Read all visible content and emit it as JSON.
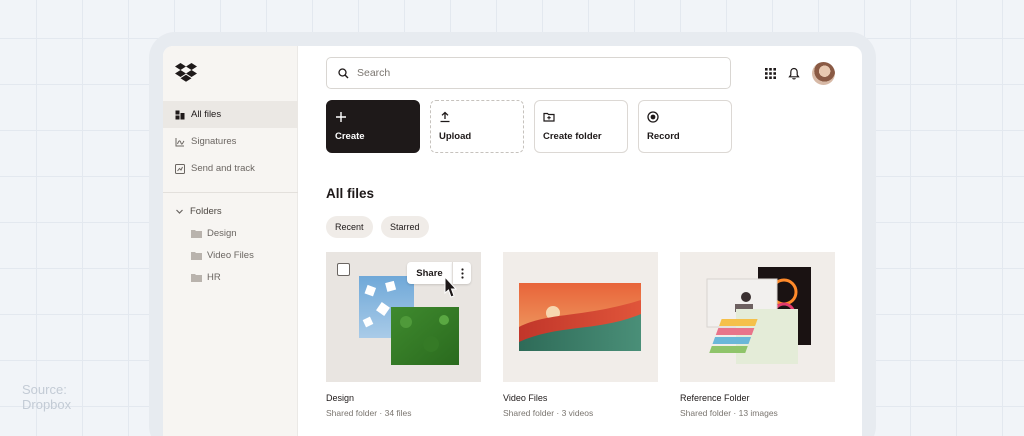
{
  "source_note": "Source:\nDropbox",
  "colors": {
    "primary": "#1e1919",
    "sidebar_bg": "#f7f5f2",
    "accent_chip": "#f0ece8"
  },
  "brand": {
    "logo_icon": "dropbox-logo-icon"
  },
  "sidebar": {
    "nav": [
      {
        "label": "All files",
        "icon": "all-files-icon",
        "active": true
      },
      {
        "label": "Signatures",
        "icon": "signature-icon",
        "active": false
      },
      {
        "label": "Send and track",
        "icon": "send-track-icon",
        "active": false
      }
    ],
    "folders_label": "Folders",
    "folders": [
      {
        "label": "Design",
        "icon": "folder-icon"
      },
      {
        "label": "Video Files",
        "icon": "folder-icon"
      },
      {
        "label": "HR",
        "icon": "folder-icon"
      }
    ]
  },
  "search": {
    "placeholder": "Search",
    "icon": "search-icon"
  },
  "topbar": {
    "apps_icon": "grid-apps-icon",
    "notifications_icon": "bell-icon",
    "avatar": "user-avatar"
  },
  "actions": [
    {
      "label": "Create",
      "icon": "plus-icon"
    },
    {
      "label": "Upload",
      "icon": "upload-icon"
    },
    {
      "label": "Create folder",
      "icon": "create-folder-icon"
    },
    {
      "label": "Record",
      "icon": "record-icon"
    }
  ],
  "main": {
    "title": "All files",
    "filters": [
      "Recent",
      "Starred"
    ],
    "cards": [
      {
        "name": "Design",
        "meta": "Shared folder · 34 files",
        "share_label": "Share"
      },
      {
        "name": "Video Files",
        "meta": "Shared folder · 3 videos"
      },
      {
        "name": "Reference Folder",
        "meta": "Shared folder · 13 images"
      }
    ]
  }
}
